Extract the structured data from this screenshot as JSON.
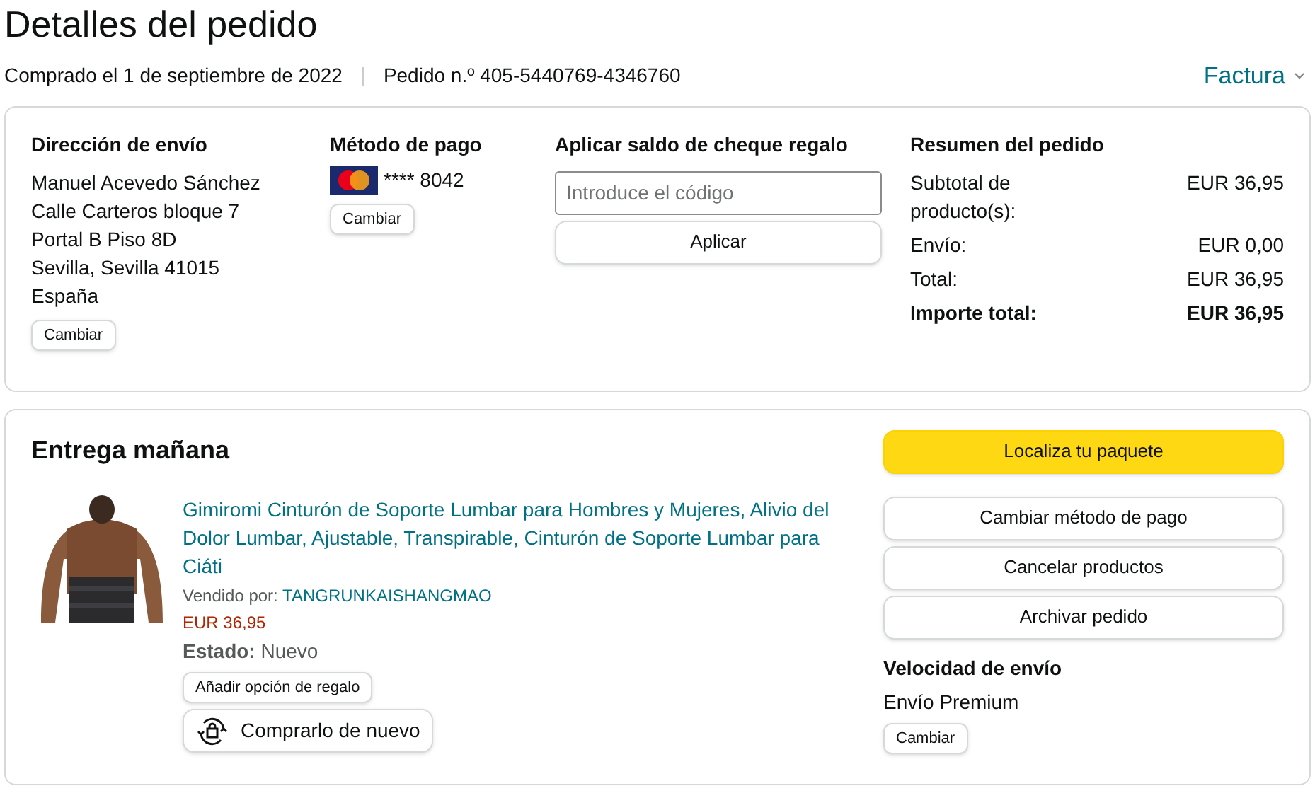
{
  "page_title": "Detalles del pedido",
  "order_date": "Comprado el 1 de septiembre de 2022",
  "order_number": "Pedido n.º 405-5440769-4346760",
  "invoice_link": "Factura",
  "shipping_address": {
    "heading": "Dirección de envío",
    "lines": [
      "Manuel Acevedo Sánchez",
      "Calle Carteros bloque 7",
      "Portal B Piso 8D",
      "Sevilla, Sevilla 41015",
      "España"
    ],
    "button": "Cambiar"
  },
  "payment_method": {
    "heading": "Método de pago",
    "card": "**** 8042",
    "button": "Cambiar"
  },
  "gift_card": {
    "heading": "Aplicar saldo de cheque regalo",
    "placeholder": "Introduce el código",
    "button": "Aplicar"
  },
  "summary": {
    "heading": "Resumen del pedido",
    "rows": [
      {
        "label": "Subtotal de producto(s):",
        "value": "EUR 36,95",
        "bold": false
      },
      {
        "label": "Envío:",
        "value": "EUR 0,00",
        "bold": false
      },
      {
        "label": "Total:",
        "value": "EUR 36,95",
        "bold": false
      },
      {
        "label": "Importe total:",
        "value": "EUR 36,95",
        "bold": true
      }
    ]
  },
  "delivery": {
    "heading": "Entrega mañana",
    "product": {
      "kind": "picture",
      "title": "Gimiromi Cinturón de Soporte Lumbar para Hombres y Mujeres, Alivio del Dolor Lumbar, Ajustable, Transpirable, Cinturón de Soporte Lumbar para Ciáti",
      "sold_by_label": "Vendido por:",
      "seller": "TANGRUNKAISHANGMAO",
      "price": "EUR 36,95",
      "condition_label": "Estado:",
      "condition": "Nuevo",
      "gift_button": "Añadir opción de regalo",
      "buy_again_button": "Comprarlo de nuevo"
    },
    "actions": [
      {
        "label": "Localiza tu paquete",
        "kind": "primary"
      },
      {
        "label": "Cambiar método de pago",
        "kind": "secondary"
      },
      {
        "label": "Cancelar productos",
        "kind": "secondary"
      },
      {
        "label": "Archivar pedido",
        "kind": "secondary"
      }
    ],
    "shipping_speed": {
      "heading": "Velocidad de envío",
      "value": "Envío Premium",
      "button": "Cambiar"
    }
  }
}
